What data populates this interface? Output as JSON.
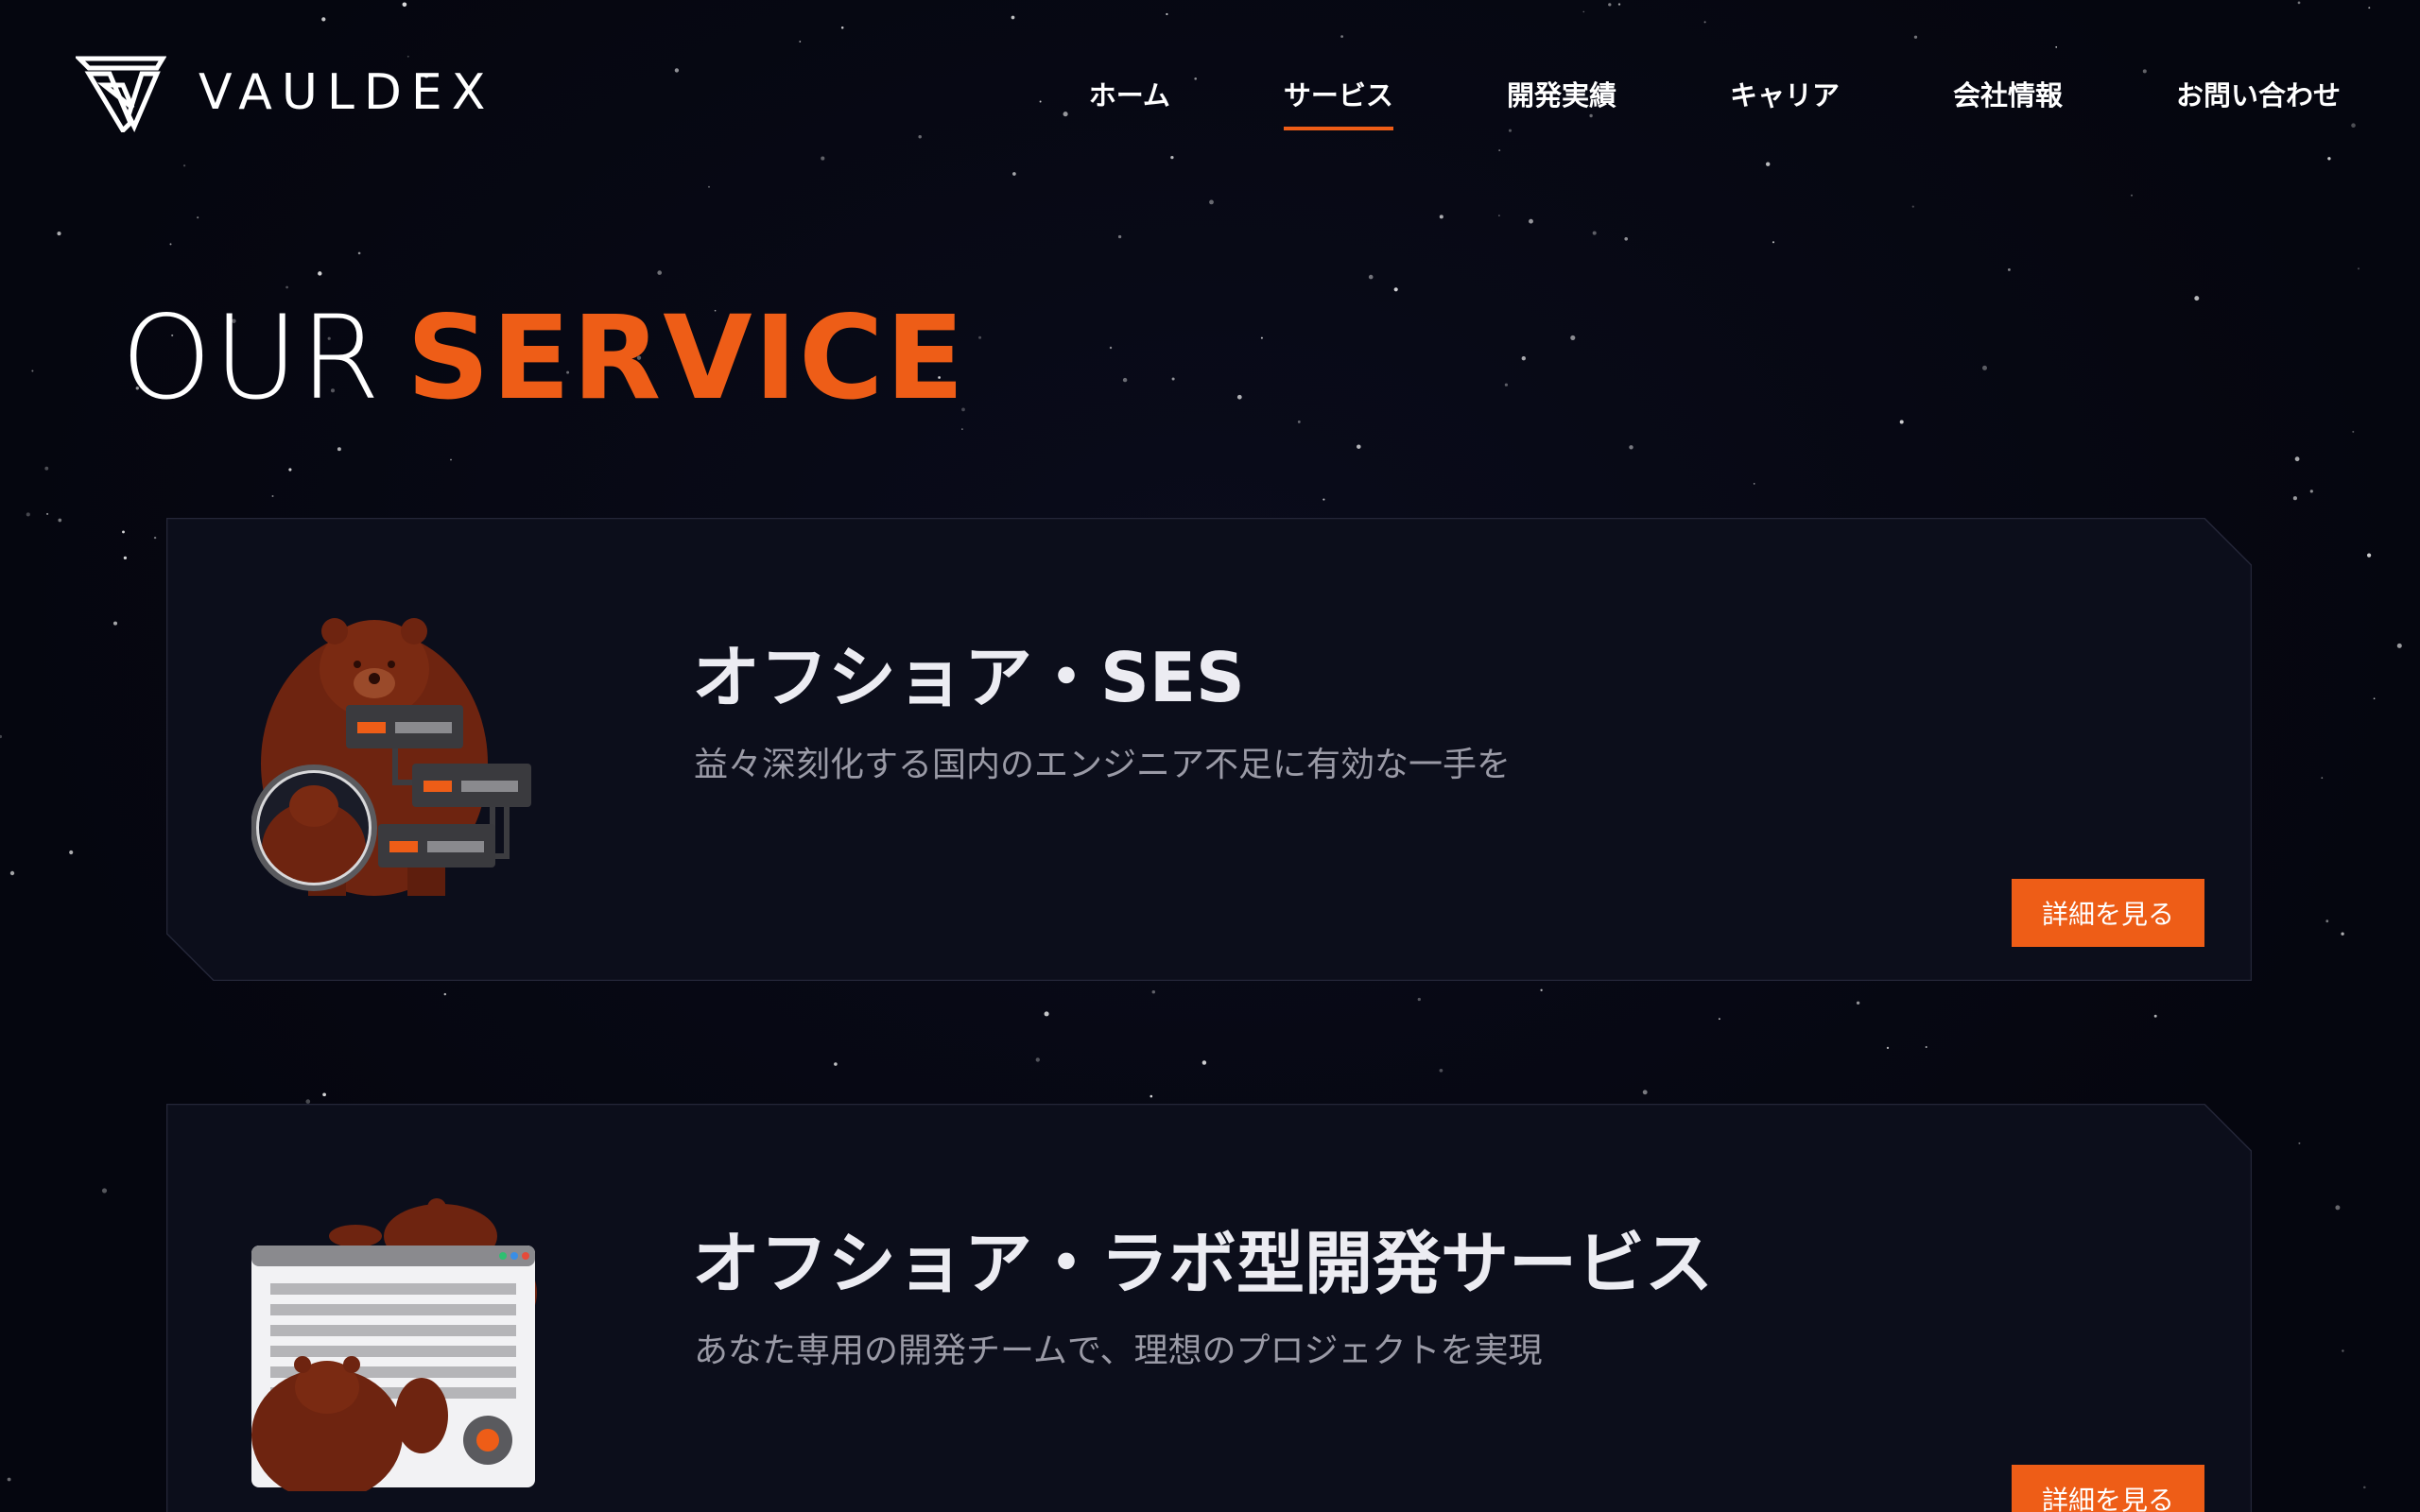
{
  "brand": {
    "name": "VAULDEX",
    "accent": "#ee5d17",
    "background": "#05060f"
  },
  "nav": {
    "items": [
      {
        "label": "ホーム"
      },
      {
        "label": "サービス"
      },
      {
        "label": "開発実績"
      },
      {
        "label": "キャリア"
      },
      {
        "label": "会社情報"
      },
      {
        "label": "お問い合わせ"
      }
    ],
    "active_index": 1
  },
  "hero": {
    "title_light": "OUR",
    "title_bold": "SERVICE"
  },
  "services": [
    {
      "title": "オフショア・SES",
      "description": "益々深刻化する国内のエンジニア不足に有効な一手を",
      "button_label": "詳細を見る",
      "illustration": "bear-with-server-nodes"
    },
    {
      "title": "オフショア・ラボ型開発サービス",
      "description": "あなた専用の開発チームで、理想のプロジェクトを実現",
      "button_label": "詳細を見る",
      "illustration": "bears-with-browser-window"
    }
  ]
}
